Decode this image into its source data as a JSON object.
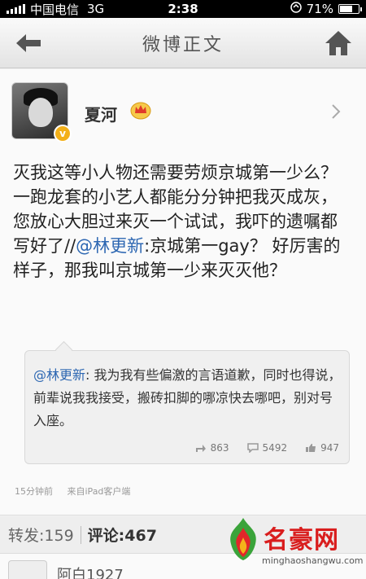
{
  "status": {
    "carrier": "中国电信",
    "network": "3G",
    "time": "2:38",
    "battery": "71%",
    "battery_level": 0.71
  },
  "nav": {
    "title": "微博正文"
  },
  "post": {
    "username": "夏河",
    "text_parts": [
      "灭我这等小人物还需要劳烦京城第一少么？一跑龙套的小艺人都能分分钟把我灭成灰，您放心大胆过来灭一个试试，我吓的遗嘱都写好了//",
      "@林更新",
      ":京城第一gay？ 好厉害的样子，那我叫京城第一少来灭灭他？"
    ],
    "repost": {
      "mention": "@林更新",
      "text": ": 我为我有些偏激的言语道歉，同时也得说，前辈说我我接受，搬砖扣脚的哪凉快去哪吧，别对号入座。",
      "reposts": "863",
      "comments": "5492",
      "likes": "947"
    },
    "meta_time": "15分钟前",
    "meta_source": "来自iPad客户端"
  },
  "tabs": {
    "repost_label": "转发:",
    "repost_count": "159",
    "comment_label": "评论:",
    "comment_count": "467"
  },
  "comment": {
    "name": "阿白1927"
  },
  "watermark": {
    "cn": "名豪网",
    "en": "minghaoshangwu.com"
  },
  "colors": {
    "link": "#2d67b2",
    "watermark_red": "#d91d1d",
    "vip_gold": "#f3b019"
  }
}
